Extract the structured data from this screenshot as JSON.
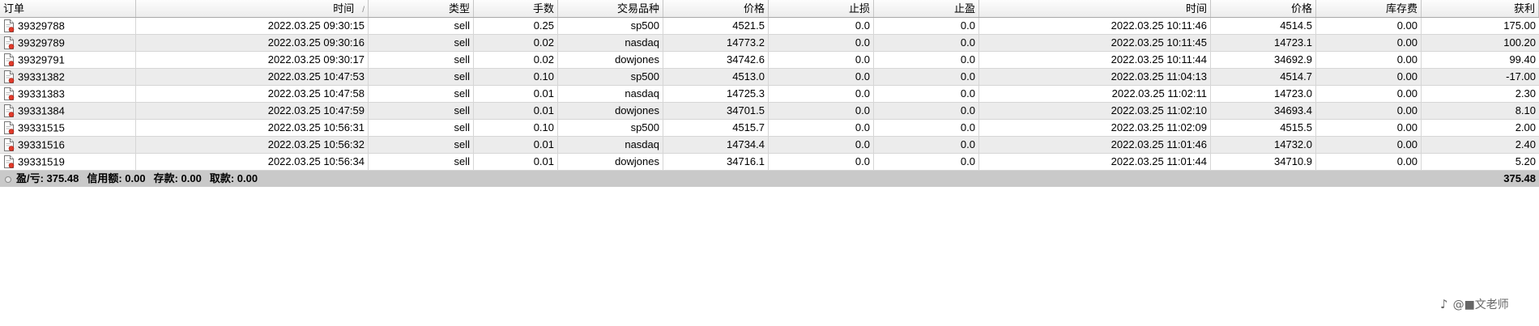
{
  "columns": [
    "订单",
    "时间",
    "类型",
    "手数",
    "交易品种",
    "价格",
    "止损",
    "止盈",
    "时间",
    "价格",
    "库存费",
    "获利"
  ],
  "sort_indicator": "/",
  "rows": [
    {
      "order": "39329788",
      "open_time": "2022.03.25 09:30:15",
      "type": "sell",
      "lots": "0.25",
      "symbol": "sp500",
      "open_price": "4521.5",
      "sl": "0.0",
      "tp": "0.0",
      "close_time": "2022.03.25 10:11:46",
      "close_price": "4514.5",
      "swap": "0.00",
      "profit": "175.00"
    },
    {
      "order": "39329789",
      "open_time": "2022.03.25 09:30:16",
      "type": "sell",
      "lots": "0.02",
      "symbol": "nasdaq",
      "open_price": "14773.2",
      "sl": "0.0",
      "tp": "0.0",
      "close_time": "2022.03.25 10:11:45",
      "close_price": "14723.1",
      "swap": "0.00",
      "profit": "100.20"
    },
    {
      "order": "39329791",
      "open_time": "2022.03.25 09:30:17",
      "type": "sell",
      "lots": "0.02",
      "symbol": "dowjones",
      "open_price": "34742.6",
      "sl": "0.0",
      "tp": "0.0",
      "close_time": "2022.03.25 10:11:44",
      "close_price": "34692.9",
      "swap": "0.00",
      "profit": "99.40"
    },
    {
      "order": "39331382",
      "open_time": "2022.03.25 10:47:53",
      "type": "sell",
      "lots": "0.10",
      "symbol": "sp500",
      "open_price": "4513.0",
      "sl": "0.0",
      "tp": "0.0",
      "close_time": "2022.03.25 11:04:13",
      "close_price": "4514.7",
      "swap": "0.00",
      "profit": "-17.00"
    },
    {
      "order": "39331383",
      "open_time": "2022.03.25 10:47:58",
      "type": "sell",
      "lots": "0.01",
      "symbol": "nasdaq",
      "open_price": "14725.3",
      "sl": "0.0",
      "tp": "0.0",
      "close_time": "2022.03.25 11:02:11",
      "close_price": "14723.0",
      "swap": "0.00",
      "profit": "2.30"
    },
    {
      "order": "39331384",
      "open_time": "2022.03.25 10:47:59",
      "type": "sell",
      "lots": "0.01",
      "symbol": "dowjones",
      "open_price": "34701.5",
      "sl": "0.0",
      "tp": "0.0",
      "close_time": "2022.03.25 11:02:10",
      "close_price": "34693.4",
      "swap": "0.00",
      "profit": "8.10"
    },
    {
      "order": "39331515",
      "open_time": "2022.03.25 10:56:31",
      "type": "sell",
      "lots": "0.10",
      "symbol": "sp500",
      "open_price": "4515.7",
      "sl": "0.0",
      "tp": "0.0",
      "close_time": "2022.03.25 11:02:09",
      "close_price": "4515.5",
      "swap": "0.00",
      "profit": "2.00"
    },
    {
      "order": "39331516",
      "open_time": "2022.03.25 10:56:32",
      "type": "sell",
      "lots": "0.01",
      "symbol": "nasdaq",
      "open_price": "14734.4",
      "sl": "0.0",
      "tp": "0.0",
      "close_time": "2022.03.25 11:01:46",
      "close_price": "14732.0",
      "swap": "0.00",
      "profit": "2.40"
    },
    {
      "order": "39331519",
      "open_time": "2022.03.25 10:56:34",
      "type": "sell",
      "lots": "0.01",
      "symbol": "dowjones",
      "open_price": "34716.1",
      "sl": "0.0",
      "tp": "0.0",
      "close_time": "2022.03.25 11:01:44",
      "close_price": "34710.9",
      "swap": "0.00",
      "profit": "5.20"
    }
  ],
  "summary": {
    "pl_text": "盈/亏: 375.48",
    "credit_text": "信用额: 0.00",
    "deposit_text": "存款: 0.00",
    "withdrawal_text": "取款: 0.00",
    "total": "375.48"
  },
  "watermark": {
    "icon_name": "tiktok-logo-icon",
    "icon": "♪",
    "text": "@■文老师"
  },
  "colors": {
    "alt_row": "#ececec",
    "summary_bar": "#c9c9c9",
    "icon_badge": "#e03a2a"
  }
}
